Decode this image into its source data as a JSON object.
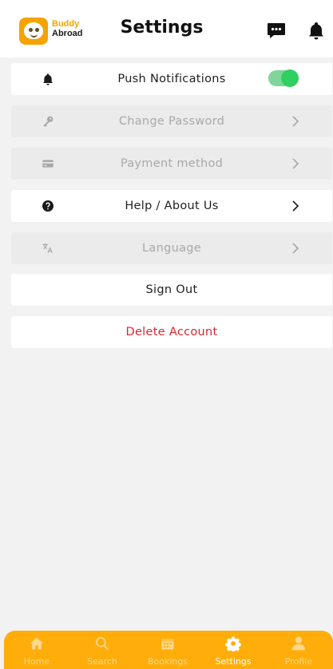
{
  "header": {
    "brand_line1": "Buddy",
    "brand_line2": "Abroad",
    "title": "Settings",
    "icons": [
      "chat-icon",
      "bell-icon"
    ]
  },
  "settings": {
    "push_notifications": {
      "label": "Push Notifications",
      "icon": "bell-icon",
      "enabled": true
    },
    "change_password": {
      "label": "Change Password",
      "icon": "key-icon"
    },
    "payment_method": {
      "label": "Payment method",
      "icon": "credit-card-icon"
    },
    "help_about": {
      "label": "Help / About Us",
      "icon": "help-circle-icon"
    },
    "language": {
      "label": "Language",
      "icon": "translate-icon"
    },
    "sign_out": {
      "label": "Sign Out"
    },
    "delete_account": {
      "label": "Delete Account"
    }
  },
  "nav": {
    "items": [
      {
        "label": "Home",
        "icon": "home-icon"
      },
      {
        "label": "Search",
        "icon": "search-icon"
      },
      {
        "label": "Bookings",
        "icon": "calendar-icon"
      },
      {
        "label": "Settings",
        "icon": "gear-icon",
        "active": true
      },
      {
        "label": "Profile",
        "icon": "person-icon"
      }
    ]
  },
  "colors": {
    "brand_orange": "#ffad0a",
    "toggle_on": "#2fcf60",
    "danger": "#e0242e",
    "disabled_row": "#ebebeb"
  }
}
